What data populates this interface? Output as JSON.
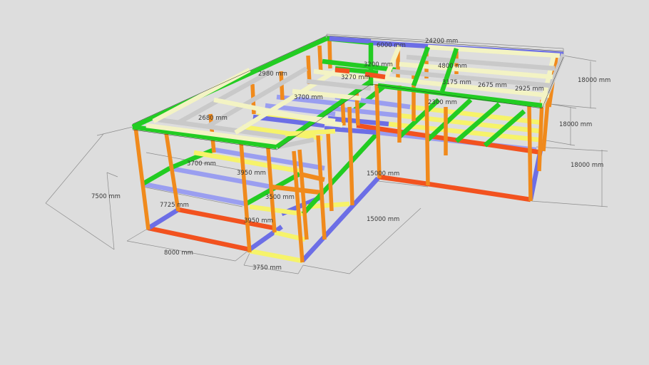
{
  "colors": {
    "background": "#dddddd",
    "column": "#f08a1c",
    "beam_red": "#f2521f",
    "beam_blue": "#6c6ee6",
    "beam_lilac": "#9a9ef0",
    "beam_green": "#22cc22",
    "beam_yellow": "#f6f36a",
    "beam_cream": "#f3f3c4",
    "beam_grey": "#c9c9c9"
  },
  "dimensions": {
    "total_length": "24200 mm",
    "top_height": "18000 mm",
    "mid_height": "18000 mm",
    "right_height": "18000 mm",
    "left_depth": "7500 mm",
    "left_width": "8000 mm",
    "front_bay": "3750 mm",
    "wing_length": "15000 mm",
    "inner_15000": "15000 mm",
    "d_3700": "3700 mm",
    "d_3950": "3950 mm",
    "d_3500": "3500 mm",
    "d_3950b": "3950 mm",
    "d_7725": "7725 mm",
    "d_2680": "2680 mm",
    "d_2980": "2980 mm",
    "d_6000": "6000 mm",
    "d_3200": "3200 mm",
    "d_3270": "3270 mm",
    "d_3700b": "3700 mm",
    "d_4800": "4800 mm",
    "d_3175": "3175 mm",
    "d_2675": "2675 mm",
    "d_2925": "2925 mm",
    "d_2300": "2300 mm"
  }
}
